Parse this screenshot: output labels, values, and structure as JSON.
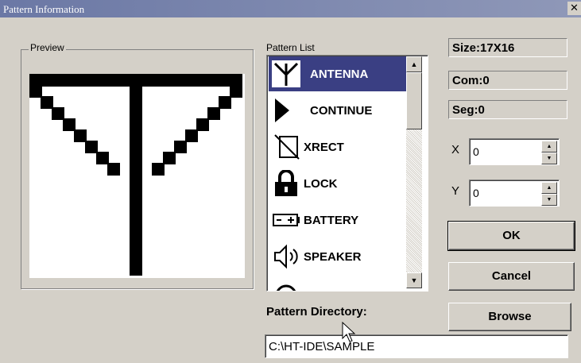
{
  "window": {
    "title": "Pattern Information",
    "close_glyph": "✕"
  },
  "preview": {
    "label": "Preview"
  },
  "pattern_list": {
    "label": "Pattern List",
    "selected_index": 0,
    "items": [
      {
        "label": "ANTENNA",
        "icon": "antenna-icon"
      },
      {
        "label": "CONTINUE",
        "icon": "play-triangle-icon"
      },
      {
        "label": "XRECT",
        "icon": "crossed-rect-icon"
      },
      {
        "label": "LOCK",
        "icon": "lock-icon"
      },
      {
        "label": "BATTERY",
        "icon": "battery-icon"
      },
      {
        "label": "SPEAKER",
        "icon": "speaker-icon"
      },
      {
        "label": "",
        "icon": "partial-icon"
      }
    ]
  },
  "info": {
    "size": "Size:17X16",
    "com": "Com:0",
    "seg": "Seg:0"
  },
  "coords": {
    "x_label": "X",
    "x_value": "0",
    "y_label": "Y",
    "y_value": "0"
  },
  "buttons": {
    "ok": "OK",
    "cancel": "Cancel",
    "browse": "Browse"
  },
  "directory": {
    "label": "Pattern Directory:",
    "value": "C:\\HT-IDE\\SAMPLE"
  },
  "colors": {
    "title_bar": "#6b78a5",
    "selection": "#3a3f83",
    "face": "#d4d0c8"
  }
}
